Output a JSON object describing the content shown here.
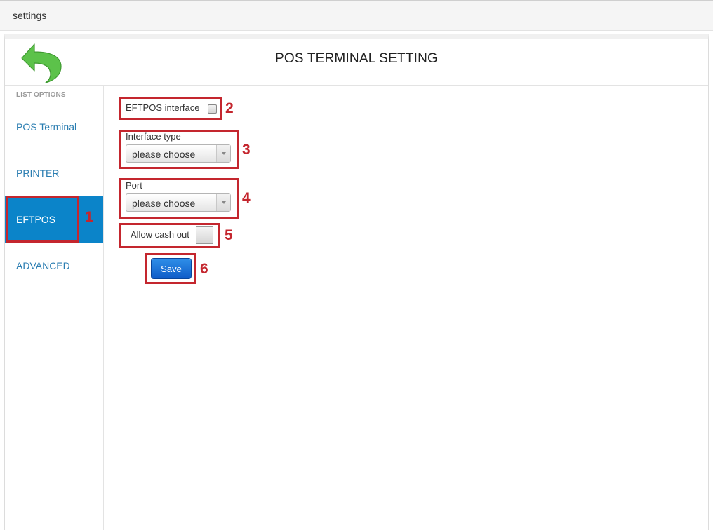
{
  "window": {
    "title": "settings"
  },
  "header": {
    "title": "POS TERMINAL SETTING",
    "back_icon": "curved-back-arrow-icon"
  },
  "sidebar": {
    "heading": "LIST OPTIONS",
    "items": [
      {
        "label": "POS Terminal",
        "active": false
      },
      {
        "label": "PRINTER",
        "active": false
      },
      {
        "label": "EFTPOS",
        "active": true
      },
      {
        "label": "ADVANCED",
        "active": false
      }
    ]
  },
  "form": {
    "eftpos_interface_label": "EFTPOS interface",
    "interface_type_label": "Interface type",
    "interface_type_value": "please choose",
    "port_label": "Port",
    "port_value": "please choose",
    "allow_cash_out_label": "Allow cash out",
    "save_label": "Save"
  },
  "annotations": [
    "1",
    "2",
    "3",
    "4",
    "5",
    "6"
  ],
  "colors": {
    "accent": "#0b84c9",
    "link": "#2a7db1",
    "annotation": "#c4262e",
    "back_arrow": "#5cc24a",
    "save_button": "#0f5cc8"
  }
}
